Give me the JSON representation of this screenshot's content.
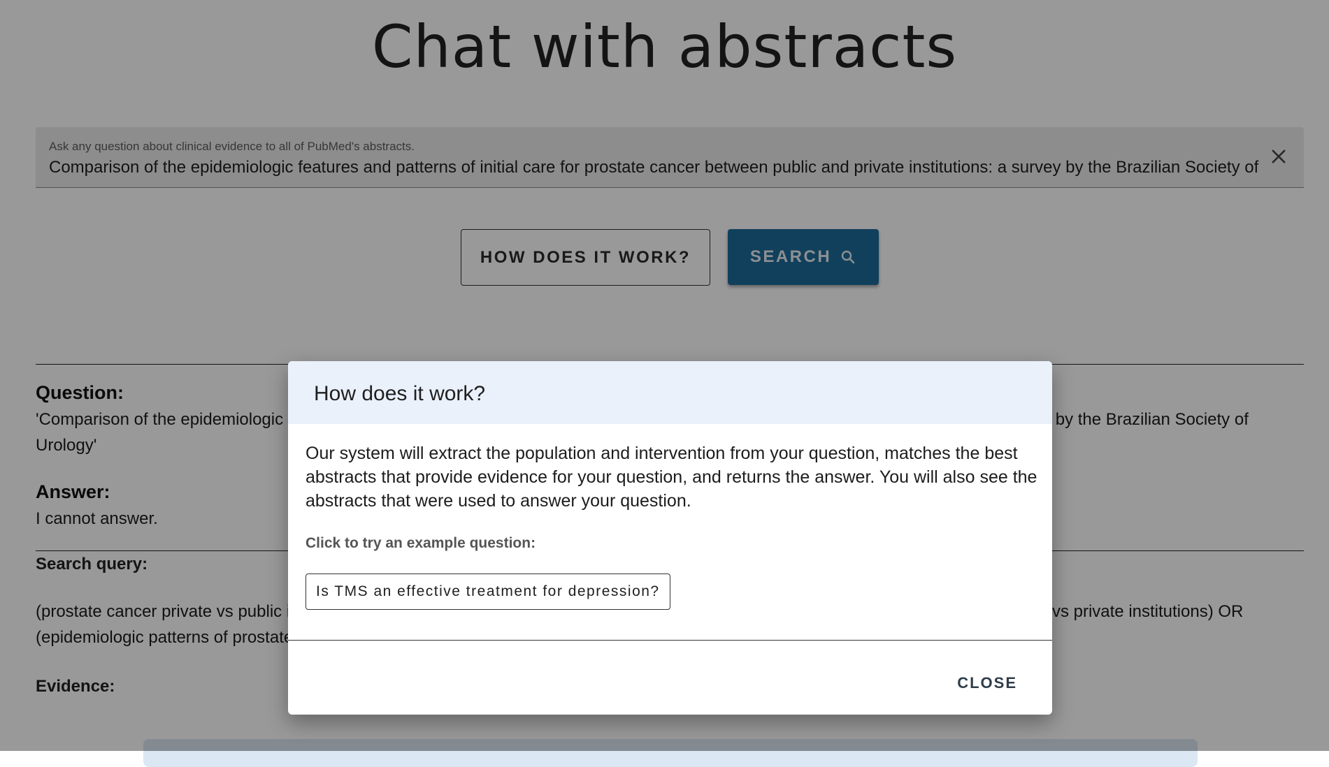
{
  "app": {
    "title": "Chat with abstracts"
  },
  "search": {
    "label": "Ask any question about clinical evidence to all of PubMed's abstracts.",
    "value": "Comparison of the epidemiologic features and patterns of initial care for prostate cancer between public and private institutions: a survey by the Brazilian Society of Urology"
  },
  "buttons": {
    "how_label": "HOW DOES IT WORK?",
    "search_label": "SEARCH"
  },
  "results": {
    "question_heading": "Question:",
    "question_text": "'Comparison of the epidemiologic features and patterns of initial care for prostate cancer between public and private institutions: a survey by the Brazilian Society of Urology'",
    "answer_heading": "Answer:",
    "answer_text": "I cannot answer.",
    "query_heading": "Search query:",
    "query_text": "(prostate cancer private vs public institutions initial care) OR (prostate cancer epidemiology Brazil) OR (prostate cancer initial care public vs private institutions) OR (epidemiologic patterns of prostate cancer Brazilian Society of Urology) OR (prostate cancer treatment differences)",
    "evidence_heading": "Evidence:"
  },
  "dialog": {
    "title": "How does it work?",
    "description": "Our system will extract the population and intervention from your question, matches the best abstracts that provide evidence for your question, and returns the answer. You will also see the abstracts that were used to answer your question.",
    "example_label": "Click to try an example question:",
    "example_question": "Is TMS an effective treatment for depression?",
    "close_label": "CLOSE"
  },
  "icons": {
    "clear": "close-icon",
    "search": "search-icon"
  },
  "colors": {
    "primary": "#1d6b9a",
    "dialog_header": "#eaf1fb",
    "overlay": "rgba(0,0,0,0.4)"
  }
}
